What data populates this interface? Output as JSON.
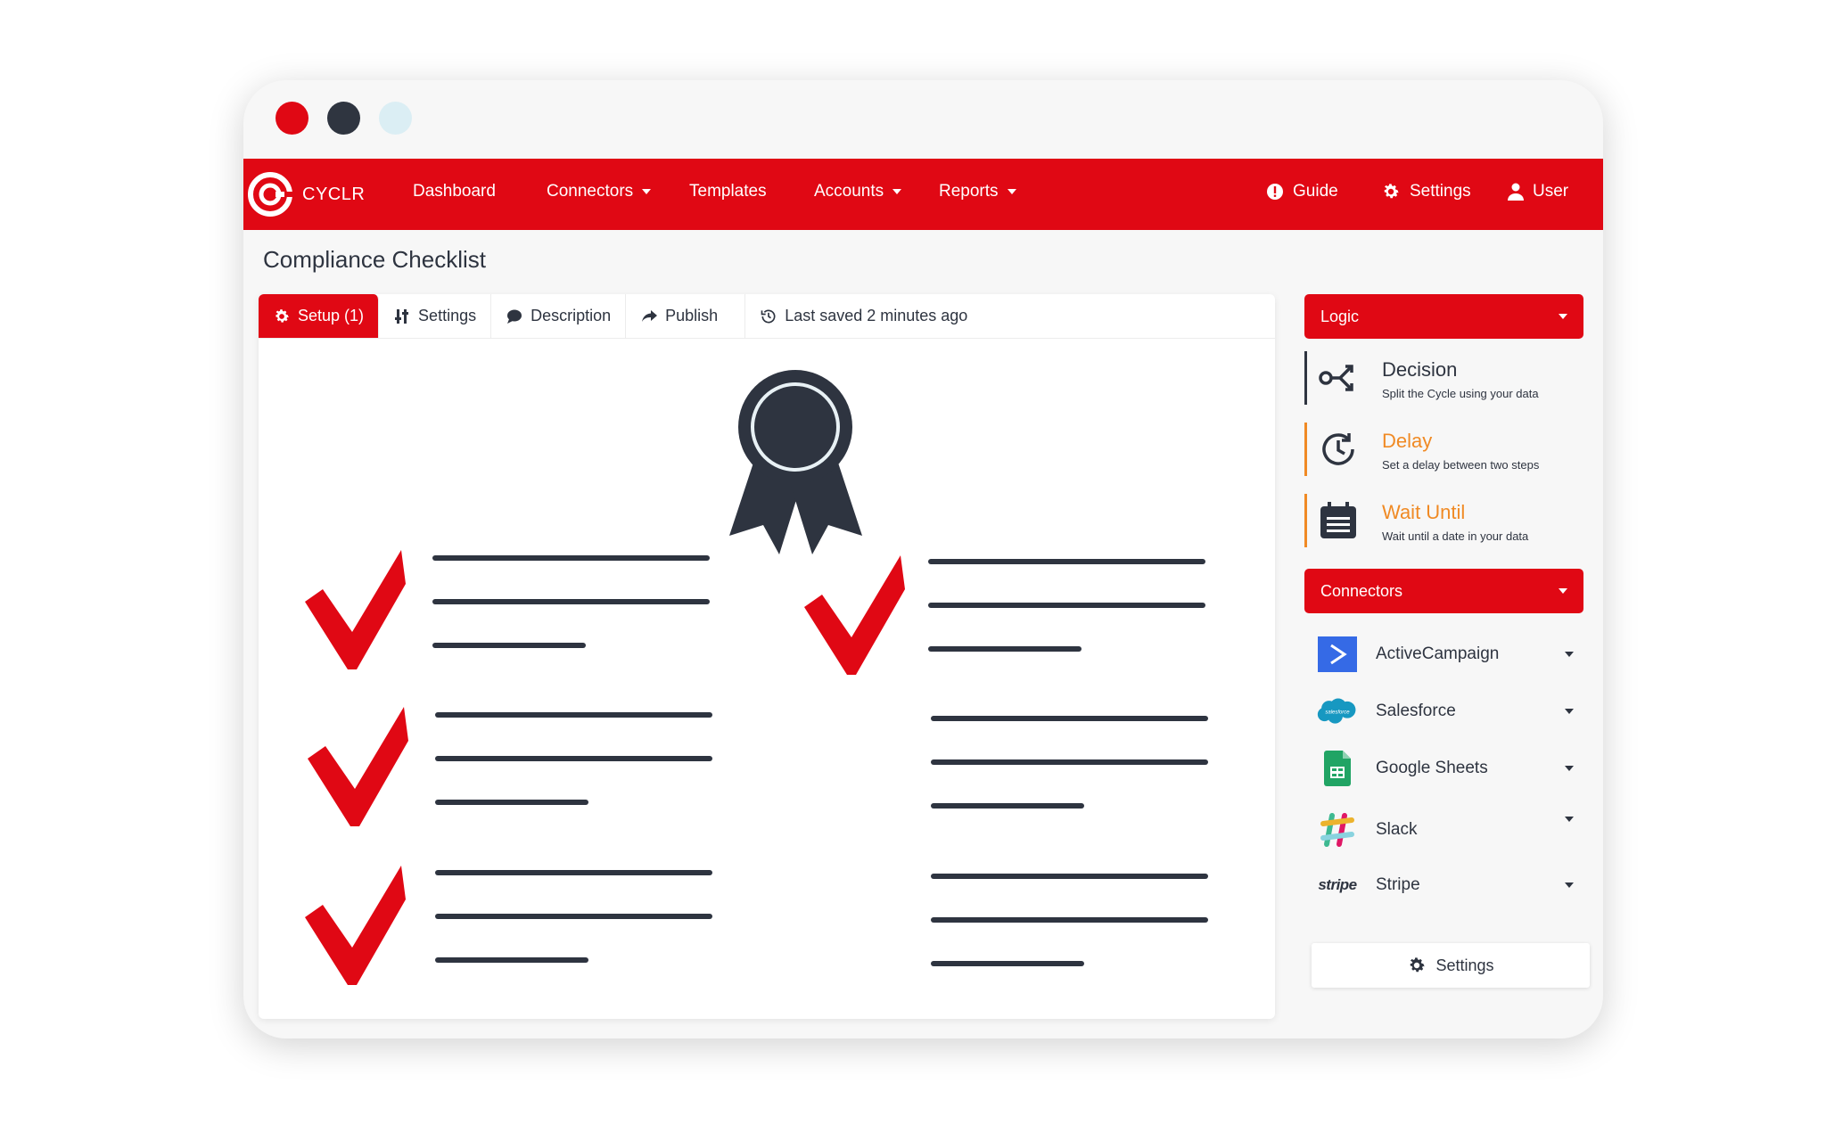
{
  "window": {
    "buttons": [
      "close",
      "minimize",
      "maximize"
    ]
  },
  "navbar": {
    "brand": "CYCLR",
    "items": [
      {
        "label": "Dashboard",
        "dropdown": false
      },
      {
        "label": "Connectors",
        "dropdown": true
      },
      {
        "label": "Templates",
        "dropdown": false
      },
      {
        "label": "Accounts",
        "dropdown": true
      },
      {
        "label": "Reports",
        "dropdown": true
      }
    ],
    "right": [
      {
        "label": "Guide",
        "icon": "alert-circle-icon"
      },
      {
        "label": "Settings",
        "icon": "gear-icon"
      },
      {
        "label": "User",
        "icon": "user-icon"
      }
    ],
    "color": "#e00814"
  },
  "page": {
    "title": "Compliance Checklist"
  },
  "tabs": [
    {
      "label": "Setup (1)",
      "icon": "gear-icon",
      "active": true
    },
    {
      "label": "Settings",
      "icon": "sliders-icon",
      "active": false
    },
    {
      "label": "Description",
      "icon": "speech-bubble-icon",
      "active": false
    },
    {
      "label": "Publish",
      "icon": "share-arrow-icon",
      "active": false
    }
  ],
  "status": {
    "last_saved": "Last saved 2 minutes ago",
    "icon": "history-clock-icon"
  },
  "sidebar": {
    "logic": {
      "header": "Logic",
      "items": [
        {
          "title": "Decision",
          "desc": "Split the Cycle using your data",
          "icon": "decision-branch-icon",
          "accent": "#2e3440"
        },
        {
          "title": "Delay",
          "desc": "Set a delay between two steps",
          "icon": "clock-icon",
          "accent": "#f08a24"
        },
        {
          "title": "Wait Until",
          "desc": "Wait until a date in your data",
          "icon": "calendar-icon",
          "accent": "#f08a24"
        }
      ]
    },
    "connectors": {
      "header": "Connectors",
      "items": [
        {
          "label": "ActiveCampaign",
          "icon": "activecampaign-icon"
        },
        {
          "label": "Salesforce",
          "icon": "salesforce-icon",
          "logo_text": "salesforce"
        },
        {
          "label": "Google Sheets",
          "icon": "google-sheets-icon"
        },
        {
          "label": "Slack",
          "icon": "slack-icon"
        },
        {
          "label": "Stripe",
          "icon": "stripe-icon",
          "logo_text": "stripe"
        }
      ]
    },
    "settings_button": "Settings"
  },
  "colors": {
    "accent": "#e00814",
    "dark": "#2e3440",
    "orange": "#f08a24"
  }
}
